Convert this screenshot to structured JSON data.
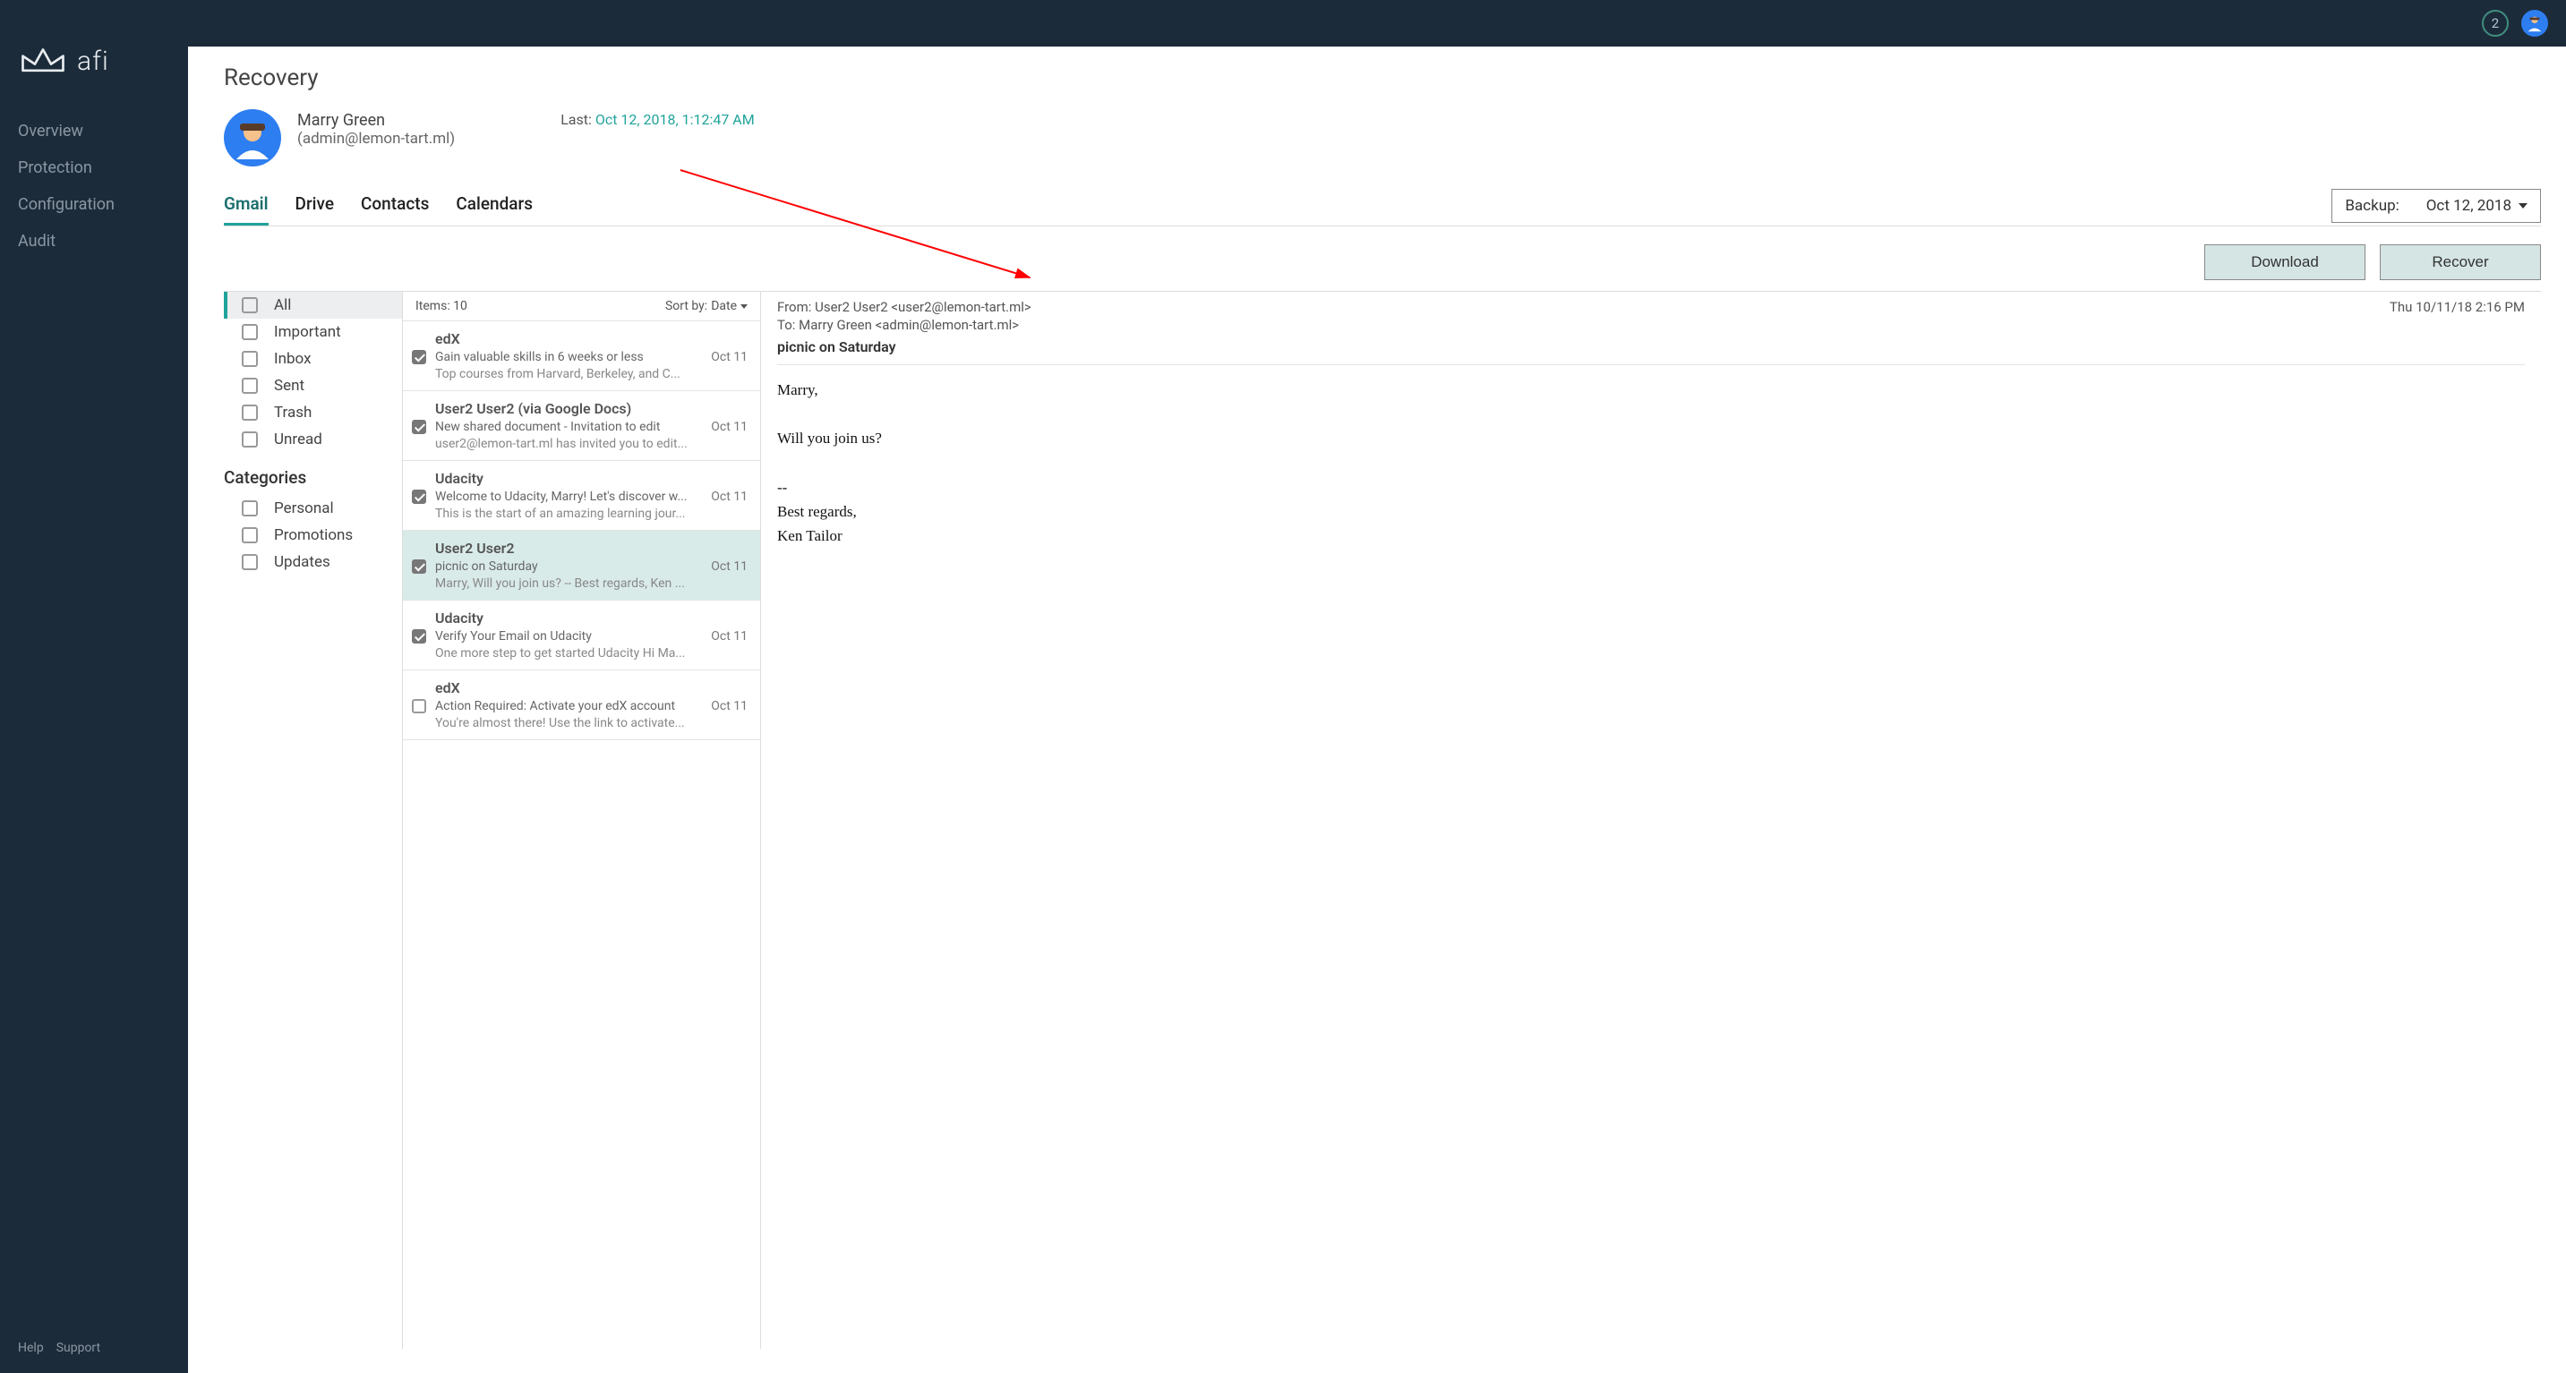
{
  "brand": {
    "name": "afi"
  },
  "nav": {
    "items": [
      {
        "label": "Overview"
      },
      {
        "label": "Protection"
      },
      {
        "label": "Configuration"
      },
      {
        "label": "Audit"
      }
    ],
    "help": "Help",
    "support": "Support"
  },
  "topbar": {
    "badge_count": "2"
  },
  "page": {
    "title": "Recovery",
    "user_name": "Marry Green",
    "user_email": "(admin@lemon-tart.ml)",
    "last_label": "Last: ",
    "last_value": "Oct 12, 2018, 1:12:47 AM"
  },
  "tabs": [
    {
      "label": "Gmail",
      "active": true
    },
    {
      "label": "Drive"
    },
    {
      "label": "Contacts"
    },
    {
      "label": "Calendars"
    }
  ],
  "backup_selector": {
    "label": "Backup:",
    "value": "Oct 12, 2018"
  },
  "actions": {
    "download": "Download",
    "recover": "Recover"
  },
  "folders": {
    "list": [
      {
        "label": "All",
        "selected": true
      },
      {
        "label": "Important"
      },
      {
        "label": "Inbox"
      },
      {
        "label": "Sent"
      },
      {
        "label": "Trash"
      },
      {
        "label": "Unread"
      }
    ],
    "categories_heading": "Categories",
    "categories": [
      {
        "label": "Personal"
      },
      {
        "label": "Promotions"
      },
      {
        "label": "Updates"
      }
    ]
  },
  "messages": {
    "items_label": "Items: 10",
    "sort_label": "Sort by:",
    "sort_value": "Date",
    "list": [
      {
        "sender": "edX",
        "subject": "Gain valuable skills in 6 weeks or less",
        "preview": "Top courses from Harvard, Berkeley, and C...",
        "date": "Oct 11",
        "checked": true
      },
      {
        "sender": "User2 User2 (via Google Docs)",
        "subject": "New shared document - Invitation to edit",
        "preview": "user2@lemon-tart.ml has invited you to edit...",
        "date": "Oct 11",
        "checked": true
      },
      {
        "sender": "Udacity",
        "subject": "Welcome to Udacity, Marry! Let's discover w...",
        "preview": "This is the start of an amazing learning jour...",
        "date": "Oct 11",
        "checked": true
      },
      {
        "sender": "User2 User2",
        "subject": "picnic on Saturday",
        "preview": "Marry, Will you join us? -- Best regards, Ken ...",
        "date": "Oct 11",
        "checked": true,
        "selected": true
      },
      {
        "sender": "Udacity",
        "subject": "Verify Your Email on Udacity",
        "preview": "One more step to get started Udacity Hi Ma...",
        "date": "Oct 11",
        "checked": true
      },
      {
        "sender": "edX",
        "subject": "Action Required: Activate your edX account",
        "preview": "You're almost there! Use the link to activate...",
        "date": "Oct 11",
        "checked": false
      }
    ]
  },
  "preview": {
    "from": "From: User2 User2 <user2@lemon-tart.ml>",
    "to": "To: Marry Green <admin@lemon-tart.ml>",
    "date": "Thu 10/11/18 2:16 PM",
    "subject": "picnic on Saturday",
    "body": "Marry,\n\nWill you join us?\n\n--\nBest regards,\nKen Tailor"
  }
}
